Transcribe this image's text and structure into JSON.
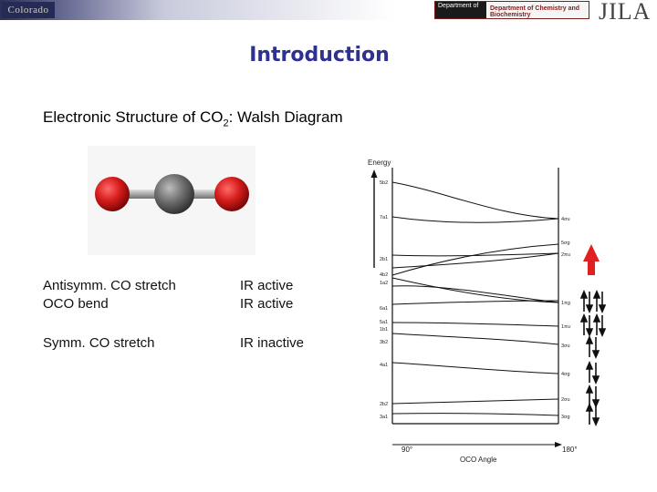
{
  "header": {
    "left_logo_text": "Colorado",
    "dept_text": "Department of Chemistry and Biochemistry",
    "dept_small": "Department of",
    "jila": "JILA"
  },
  "slide": {
    "title": "Introduction",
    "subtitle_main": "Electronic Structure of CO",
    "subtitle_sub": "2",
    "subtitle_tail": ": Walsh Diagram"
  },
  "modes": [
    {
      "name": "Antisymm. CO stretch",
      "activity": "IR active"
    },
    {
      "name": "OCO bend",
      "activity": "IR active"
    },
    {
      "name": "Symm. CO stretch",
      "activity": "IR inactive"
    }
  ],
  "diagram": {
    "energy_label": "Energy",
    "x_axis_label": "OCO Angle",
    "angle_left": "90°",
    "angle_right": "180°",
    "left_orbitals": [
      "5b2",
      "7a1",
      "2b1",
      "4b2",
      "1a2",
      "6a1",
      "5a1",
      "1b1",
      "3b2",
      "4a1",
      "2b2",
      "3a1"
    ],
    "right_orbitals": [
      "4σu",
      "5σg",
      "2πu",
      "1πg",
      "1πu",
      "3σu",
      "4σg",
      "2σu",
      "3σg"
    ],
    "arrow_color": "#e02020"
  }
}
